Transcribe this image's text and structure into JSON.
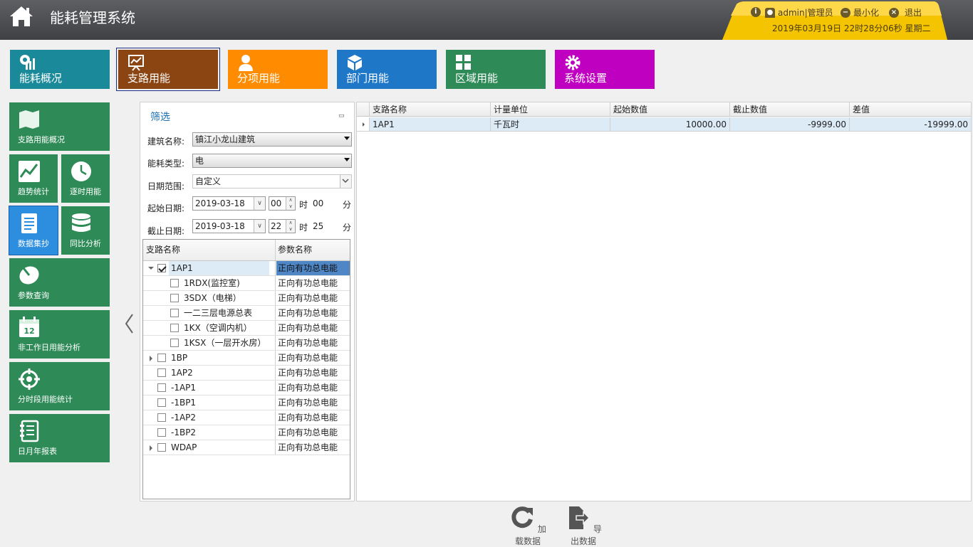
{
  "app": {
    "title": "能耗管理系统"
  },
  "user": {
    "name": "admin|管理员",
    "minimize": "最小化",
    "logout": "退出",
    "datetime": "2019年03月19日 22时28分06秒 星期二"
  },
  "nav": [
    {
      "label": "能耗概况",
      "color": "#1a8a9a"
    },
    {
      "label": "支路用能",
      "color": "#8b4513"
    },
    {
      "label": "分项用能",
      "color": "#ff8c00"
    },
    {
      "label": "部门用能",
      "color": "#1f77c8"
    },
    {
      "label": "区域用能",
      "color": "#2e8b57"
    },
    {
      "label": "系统设置",
      "color": "#c000c0"
    }
  ],
  "side": [
    {
      "label": "支路用能概况"
    },
    {
      "label": "趋势统计"
    },
    {
      "label": "逐时用能"
    },
    {
      "label": "数据集抄"
    },
    {
      "label": "同比分析"
    },
    {
      "label": "参数查询"
    },
    {
      "label": "非工作日用能分析"
    },
    {
      "label": "分时段用能统计"
    },
    {
      "label": "日月年报表"
    }
  ],
  "filter": {
    "title": "筛选",
    "building_label": "建筑名称:",
    "building_value": "镇江小龙山建筑",
    "energy_label": "能耗类型:",
    "energy_value": "电",
    "range_label": "日期范围:",
    "range_value": "自定义",
    "start_label": "起始日期:",
    "start_date": "2019-03-18",
    "start_hour": "00",
    "start_min": "00",
    "end_label": "截止日期:",
    "end_date": "2019-03-18",
    "end_hour": "22",
    "end_min": "25",
    "hour_unit": "时",
    "min_unit": "分"
  },
  "tree": {
    "headers": [
      "支路名称",
      "参数名称"
    ],
    "rows": [
      {
        "name": "1AP1",
        "param": "正向有功总电能",
        "level": 0,
        "expand": "open",
        "checked": true
      },
      {
        "name": "1RDX(监控室)",
        "param": "正向有功总电能",
        "level": 1,
        "expand": "",
        "checked": false
      },
      {
        "name": "3SDX（电梯）",
        "param": "正向有功总电能",
        "level": 1,
        "expand": "",
        "checked": false
      },
      {
        "name": "一二三层电源总表",
        "param": "正向有功总电能",
        "level": 1,
        "expand": "",
        "checked": false
      },
      {
        "name": "1KX（空调内机）",
        "param": "正向有功总电能",
        "level": 1,
        "expand": "",
        "checked": false
      },
      {
        "name": "1KSX（一层开水房）",
        "param": "正向有功总电能",
        "level": 1,
        "expand": "",
        "checked": false
      },
      {
        "name": "1BP",
        "param": "正向有功总电能",
        "level": 0,
        "expand": "col",
        "checked": false
      },
      {
        "name": "1AP2",
        "param": "正向有功总电能",
        "level": 0,
        "expand": "",
        "checked": false
      },
      {
        "name": "-1AP1",
        "param": "正向有功总电能",
        "level": 0,
        "expand": "",
        "checked": false
      },
      {
        "name": "-1BP1",
        "param": "正向有功总电能",
        "level": 0,
        "expand": "",
        "checked": false
      },
      {
        "name": "-1AP2",
        "param": "正向有功总电能",
        "level": 0,
        "expand": "",
        "checked": false
      },
      {
        "name": "-1BP2",
        "param": "正向有功总电能",
        "level": 0,
        "expand": "",
        "checked": false
      },
      {
        "name": "WDAP",
        "param": "正向有功总电能",
        "level": 0,
        "expand": "col",
        "checked": false
      }
    ]
  },
  "grid": {
    "headers": [
      "支路名称",
      "计量单位",
      "起始数值",
      "截止数值",
      "差值"
    ],
    "rows": [
      [
        "1AP1",
        "千瓦时",
        "10000.00",
        "-9999.00",
        "-19999.00"
      ]
    ]
  },
  "actions": {
    "load": "加载数据",
    "export": "导出数据"
  }
}
